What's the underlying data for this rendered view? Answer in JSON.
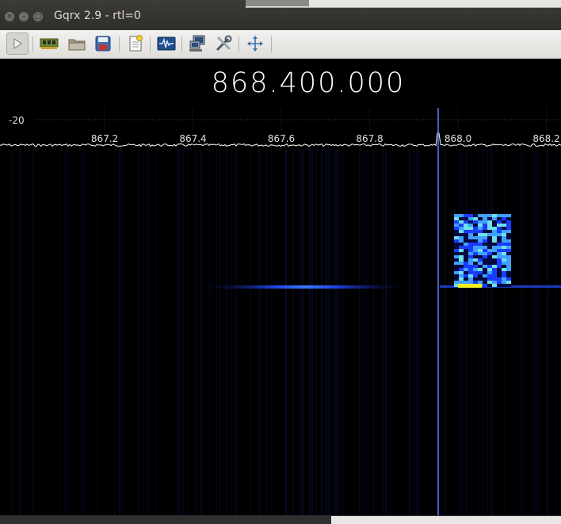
{
  "window": {
    "title": "Gqrx 2.9 - rtl=0"
  },
  "window_buttons": {
    "close_icon": "close-icon",
    "minimize_icon": "minimize-icon",
    "maximize_icon": "maximize-icon"
  },
  "toolbar": {
    "items": [
      {
        "name": "start-dsp-button",
        "icon": "play-icon"
      },
      {
        "name": "io-devices-button",
        "icon": "hardware-card-icon"
      },
      {
        "name": "open-settings-button",
        "icon": "folder-icon"
      },
      {
        "name": "save-settings-button",
        "icon": "floppy-disk-icon"
      },
      {
        "name": "remote-control-button",
        "icon": "document-star-icon"
      },
      {
        "name": "dsp-toggle-button",
        "icon": "waveform-icon"
      },
      {
        "name": "remote-network-button",
        "icon": "computer-network-icon"
      },
      {
        "name": "configure-button",
        "icon": "tools-icon"
      },
      {
        "name": "fullscreen-button",
        "icon": "arrows-expand-icon"
      }
    ]
  },
  "frequency": {
    "display": "868.400.000"
  },
  "spectrum": {
    "db_label": "-20",
    "ticks": [
      "867.2",
      "867.4",
      "867.6",
      "867.8",
      "868.0",
      "868.2"
    ],
    "line_color": "#ffffff",
    "grid_color": "#3a3a3a"
  },
  "waterfall": {
    "background": "#000000",
    "marker_color": "#5a7dff",
    "signal_colors": [
      "#1a3cff",
      "#3fa0ff",
      "#6fe0e8",
      "#f0f020"
    ]
  },
  "statusbar": {
    "left_text": ""
  }
}
